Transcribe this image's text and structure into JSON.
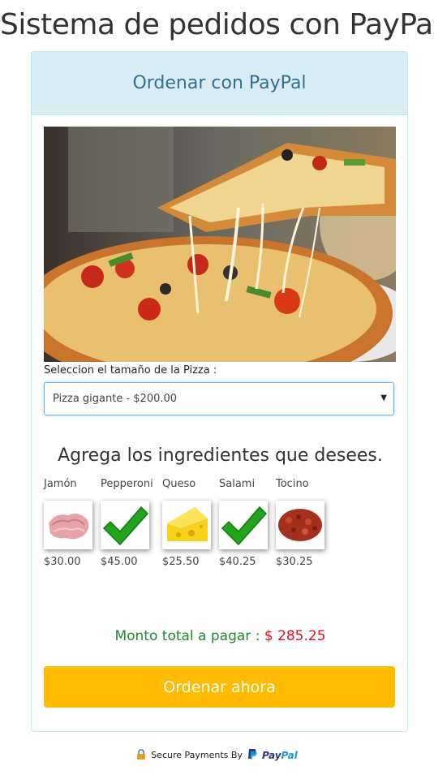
{
  "page": {
    "title": "Sistema de pedidos con PayPal"
  },
  "panel": {
    "heading": "Ordenar con PayPal"
  },
  "size": {
    "label": "Seleccion el tamaño de la Pizza :",
    "selected": "Pizza gigante - $200.00"
  },
  "ingredients": {
    "title": "Agrega los ingredientes que desees.",
    "items": [
      {
        "name": "Jamón",
        "price": "$30.00",
        "selected": false,
        "icon": "ham-icon"
      },
      {
        "name": "Pepperoni",
        "price": "$45.00",
        "selected": true,
        "icon": "checkmark-icon"
      },
      {
        "name": "Queso",
        "price": "$25.50",
        "selected": false,
        "icon": "cheese-icon"
      },
      {
        "name": "Salami",
        "price": "$40.25",
        "selected": true,
        "icon": "checkmark-icon"
      },
      {
        "name": "Tocino",
        "price": "$30.25",
        "selected": false,
        "icon": "bacon-icon"
      }
    ]
  },
  "total": {
    "label": "Monto total a pagar :",
    "amount": "$ 285.25"
  },
  "order_button": {
    "label": "Ordenar ahora"
  },
  "footer": {
    "text": "Secure Payments By",
    "brand_pay": "Pay",
    "brand_pal": "Pal"
  },
  "colors": {
    "accent_button": "#ffbb00",
    "panel_heading_bg": "#d9edf7",
    "total_label": "#1e8a2e",
    "total_amount": "#e0121a"
  }
}
